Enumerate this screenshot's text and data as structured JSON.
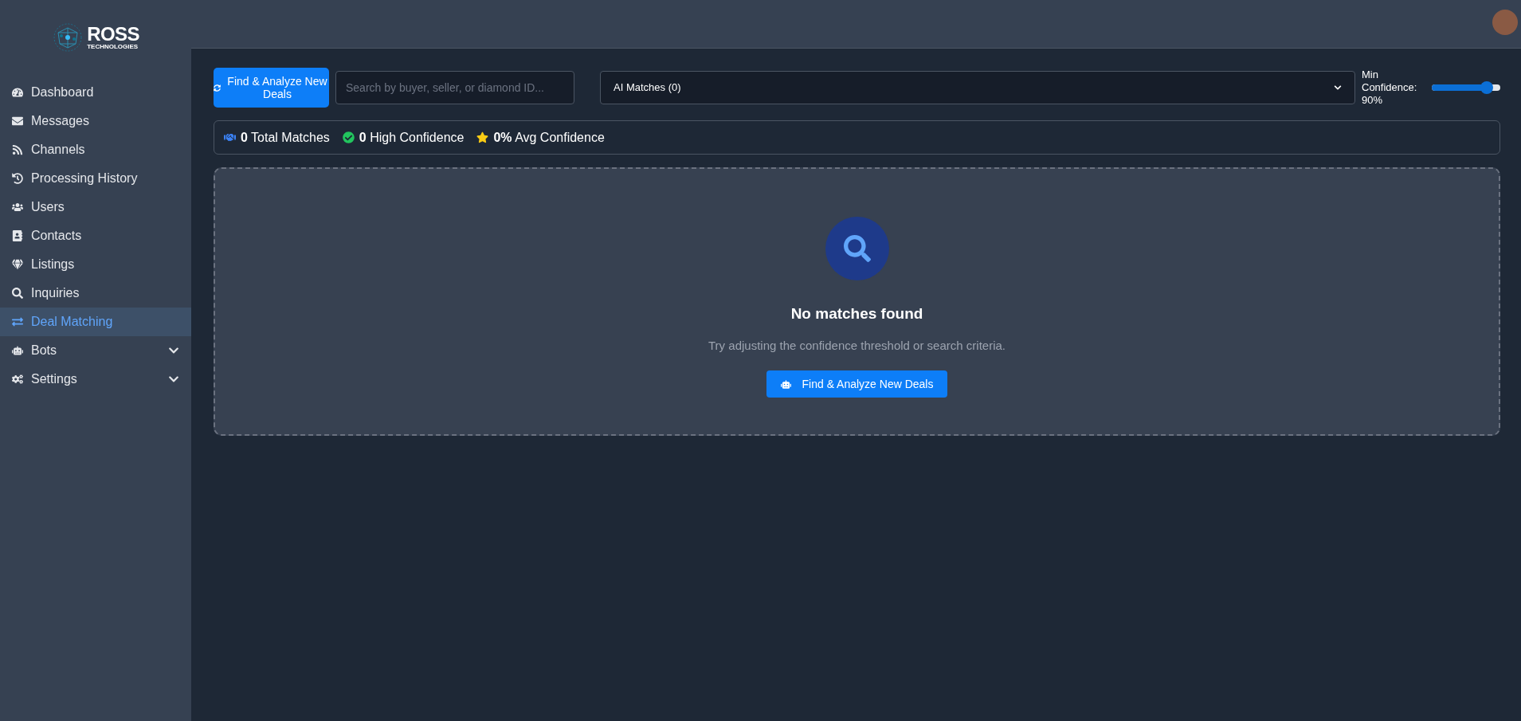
{
  "logo": {
    "title": "ROSS",
    "subtitle": "TECHNOLOGIES"
  },
  "sidebar": {
    "items": [
      {
        "label": "Dashboard",
        "selected": false
      },
      {
        "label": "Messages",
        "selected": false
      },
      {
        "label": "Channels",
        "selected": false
      },
      {
        "label": "Processing History",
        "selected": false
      },
      {
        "label": "Users",
        "selected": false
      },
      {
        "label": "Contacts",
        "selected": false
      },
      {
        "label": "Listings",
        "selected": false
      },
      {
        "label": "Inquiries",
        "selected": false
      },
      {
        "label": "Deal Matching",
        "selected": true
      },
      {
        "label": "Bots",
        "selected": false,
        "expanded": false
      },
      {
        "label": "Settings",
        "selected": false,
        "expanded": false
      }
    ]
  },
  "toolbar": {
    "analyze_button": "Find & Analyze New Deals",
    "search": {
      "placeholder": "Search by buyer, seller, or diamond ID..."
    },
    "filter": {
      "value": "AI Matches (0)"
    },
    "confidence": {
      "label": "Min Confidence: 90%",
      "level": 0.8
    }
  },
  "stats": [
    {
      "text": "**0** Total Matches"
    },
    {
      "text": "**0** High Confidence"
    },
    {
      "text": "**0%** Avg Confidence"
    }
  ],
  "empty_state": {
    "title": "No matches found",
    "message": "Try adjusting the confidence threshold or search criteria.",
    "button": "Find & Analyze New Deals"
  }
}
